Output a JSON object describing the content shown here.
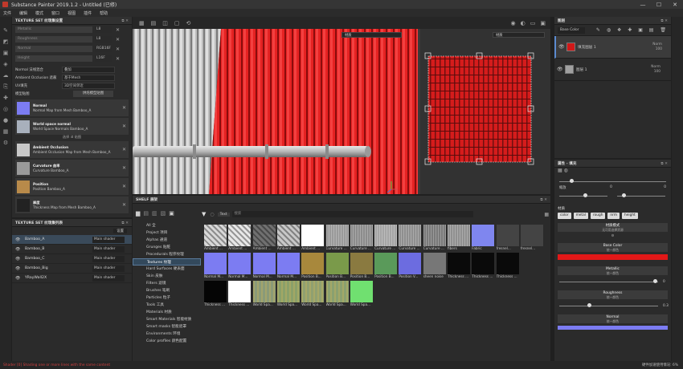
{
  "app": {
    "title": "Substance Painter 2019.1.2 - Untitled (已修)",
    "win_min": "—",
    "win_max": "☐",
    "win_close": "✕"
  },
  "menu": [
    "文件",
    "编辑",
    "模式",
    "窗口",
    "视图",
    "插件",
    "帮助"
  ],
  "texset": {
    "header": "TEXTURE SET 纹理集设置",
    "res_rows": [
      {
        "label": "Metallic",
        "v": "L8"
      },
      {
        "label": "Roughness",
        "v": "L8"
      },
      {
        "label": "Normal",
        "v": "RGB16F"
      },
      {
        "label": "Height",
        "v": "L16F"
      }
    ],
    "normal_mix": {
      "label": "Normal 法线混合",
      "value": "叠加"
    },
    "ao_dep": {
      "label": "Ambient Occlusion 遮蔽",
      "value": "基于Mesh"
    },
    "uv": {
      "label": "UV填充",
      "value": "3D空间邻近"
    },
    "model_maps": "模型贴图",
    "bake_btn": "烘焙模型贴图",
    "maps": [
      {
        "name": "Normal",
        "desc": "Normal Map from Mesh Bamboo_A",
        "color": "#7c7cf2"
      },
      {
        "name": "World space normal",
        "desc": "World Space Normals Bamboo_A",
        "color": "#a8b0bc",
        "sub": "选择 id 贴图"
      },
      {
        "name": "Ambient Occlusion",
        "desc": "Ambient Occlusion Map from Mesh Bamboo_A",
        "color": "#c8c8c8"
      },
      {
        "name": "Curvature 曲率",
        "desc": "Curvature Bamboo_A",
        "color": "#9a9a9a"
      },
      {
        "name": "Position",
        "desc": "Position Bamboo_A",
        "color": "#b88a4a"
      },
      {
        "name": "厚度",
        "desc": "Thickness Map from Mesh Bamboo_A",
        "color": "#222222"
      }
    ]
  },
  "tslist": {
    "header": "TEXTURE SET 纹理集列表",
    "settings": "设置",
    "rows": [
      {
        "name": "Bamboo_A",
        "shader": "Main shader"
      },
      {
        "name": "Bamboo_B",
        "shader": "Main shader"
      },
      {
        "name": "Bamboo_C",
        "shader": "Main shader"
      },
      {
        "name": "Bamboo_Big",
        "shader": "Main shader"
      },
      {
        "name": "YRayWall2X",
        "shader": "Main shader"
      }
    ]
  },
  "viewport": {
    "dd3d": "材质",
    "dd2d": "材质"
  },
  "shelf": {
    "header": "SHELF 展架",
    "filter": "Text",
    "search": "搜索",
    "categories": [
      "All 全",
      "Project 项目",
      "Alphas 通道",
      "Grunges 贴脏",
      "Procedurals 程序纹理",
      "Textures 纹理",
      "Hard Surfaces 硬表面",
      "Skin 皮肤",
      "Filters 滤镜",
      "Brushes 笔刷",
      "Particles 粒子",
      "Tools 工具",
      "Materials 材质",
      "Smart Materials 智能材质",
      "Smart masks 智能遮罩",
      "Environments 环境",
      "Color profiles 颜色配置"
    ],
    "tiles": [
      {
        "cap": "Ambient ...",
        "color": "#d8d8d8"
      },
      {
        "cap": "Ambient ...",
        "color": "#e8e8e8"
      },
      {
        "cap": "Ambient ...",
        "color": "#707070"
      },
      {
        "cap": "Ambient ...",
        "color": "#c8c8c8"
      },
      {
        "cap": "Ambient ...",
        "color": "#ffffff"
      },
      {
        "cap": "Curvature ...",
        "color": "#9a9a9a"
      },
      {
        "cap": "Curvature ...",
        "color": "#8c8c8c"
      },
      {
        "cap": "Curvature ...",
        "color": "#a5a5a5"
      },
      {
        "cap": "Curvature ...",
        "color": "#8f8f8f"
      },
      {
        "cap": "Curvature ...",
        "color": "#7a7a7a"
      },
      {
        "cap": "fibers",
        "color": "#909090"
      },
      {
        "cap": "Fabric",
        "color": "#7f86ef"
      },
      {
        "cap": "fresnel...",
        "color": "#444444"
      },
      {
        "cap": "fresnel...",
        "color": "#444444"
      },
      {
        "cap": "Normal M...",
        "color": "#7c7cf2"
      },
      {
        "cap": "Normal M...",
        "color": "#7c7cf2"
      },
      {
        "cap": "Normal M...",
        "color": "#7c7cf2"
      },
      {
        "cap": "Normal M...",
        "color": "#7c7cf2"
      },
      {
        "cap": "Position B...",
        "color": "#a8883c"
      },
      {
        "cap": "Position B...",
        "color": "#7a9a4a"
      },
      {
        "cap": "Position B...",
        "color": "#8a7a40"
      },
      {
        "cap": "Position B...",
        "color": "#5a9a5a"
      },
      {
        "cap": "Position V...",
        "color": "#6c6ce0"
      },
      {
        "cap": "sheen noise",
        "color": "#777777"
      },
      {
        "cap": "Thickness ...",
        "color": "#0a0a0a"
      },
      {
        "cap": "Thickness ...",
        "color": "#0a0a0a"
      },
      {
        "cap": "Thickness ...",
        "color": "#0a0a0a"
      },
      {
        "cap": "Thickness ...",
        "color": "#050505"
      },
      {
        "cap": "Thickness ...",
        "color": "#ffffff"
      },
      {
        "cap": "World Spa...",
        "color": "#8a9a78"
      },
      {
        "cap": "World Spa...",
        "color": "#8aa06a"
      },
      {
        "cap": "World Spa...",
        "color": "#90a070"
      },
      {
        "cap": "World Spa...",
        "color": "#8aa070"
      },
      {
        "cap": "World Spa...",
        "color": "#70e070"
      }
    ]
  },
  "layers": {
    "header": "图层",
    "blend": "Base Color",
    "rows": [
      {
        "name": "填充图层 1",
        "mode": "Norm",
        "opacity": "100",
        "color": "#d01818"
      },
      {
        "name": "图层 1",
        "mode": "Norm",
        "opacity": "100",
        "color": "#a0a0a0"
      }
    ]
  },
  "props": {
    "header": "属性 - 填充",
    "transform_label": "缩放",
    "v1": "0",
    "v2": "0",
    "material_label": "材质",
    "channels": [
      "color",
      "metal",
      "rough",
      "nrm",
      "height"
    ],
    "mat_mode": "材质模式",
    "mat_mode_sub": "无可用选择资源",
    "basecolor_label": "Base Color",
    "basecolor_sub": "统一颜色",
    "basecolor": "#e21818",
    "metallic": "Metallic",
    "metallic_sub": "统一颜色",
    "metallic_v": "0",
    "metallic_frac": 1.0,
    "roughness": "Roughness",
    "roughness_sub": "统一颜色",
    "roughness_v": "0.3",
    "roughness_frac": 0.3,
    "normal": "Normal",
    "normal_sub": "统一颜色"
  },
  "status": {
    "error": "Shader [0] Shading one or more lines with the same content",
    "right": "硬件加速使用情况: 6%"
  }
}
